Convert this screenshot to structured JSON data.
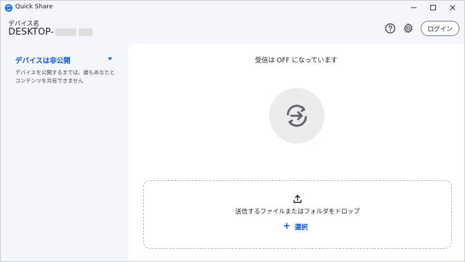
{
  "window": {
    "title": "Quick Share",
    "icon": "quick-share-icon",
    "controls": [
      "minimize-icon",
      "maximize-icon",
      "close-icon"
    ]
  },
  "header": {
    "device_label": "デバイス名",
    "device_name": "DESKTOP-",
    "help_icon": "help-icon",
    "settings_icon": "gear-icon",
    "login_label": "ログイン"
  },
  "sidebar": {
    "visibility_title": "デバイスは非公開",
    "visibility_description": "デバイスを公開するまでは、誰もあなたとコンテンツを共有できません"
  },
  "main": {
    "status": "受信は OFF になっています",
    "status_icon": "sync-off-icon",
    "dropzone": {
      "text": "送信するファイルまたはフォルダをドロップ",
      "select_label": "選択",
      "upload_icon": "upload-icon",
      "plus_icon": "plus-icon"
    }
  },
  "colors": {
    "accent": "#0b57d0",
    "background": "#f3f6fb",
    "panel": "#ffffff",
    "circle": "#ececec"
  }
}
